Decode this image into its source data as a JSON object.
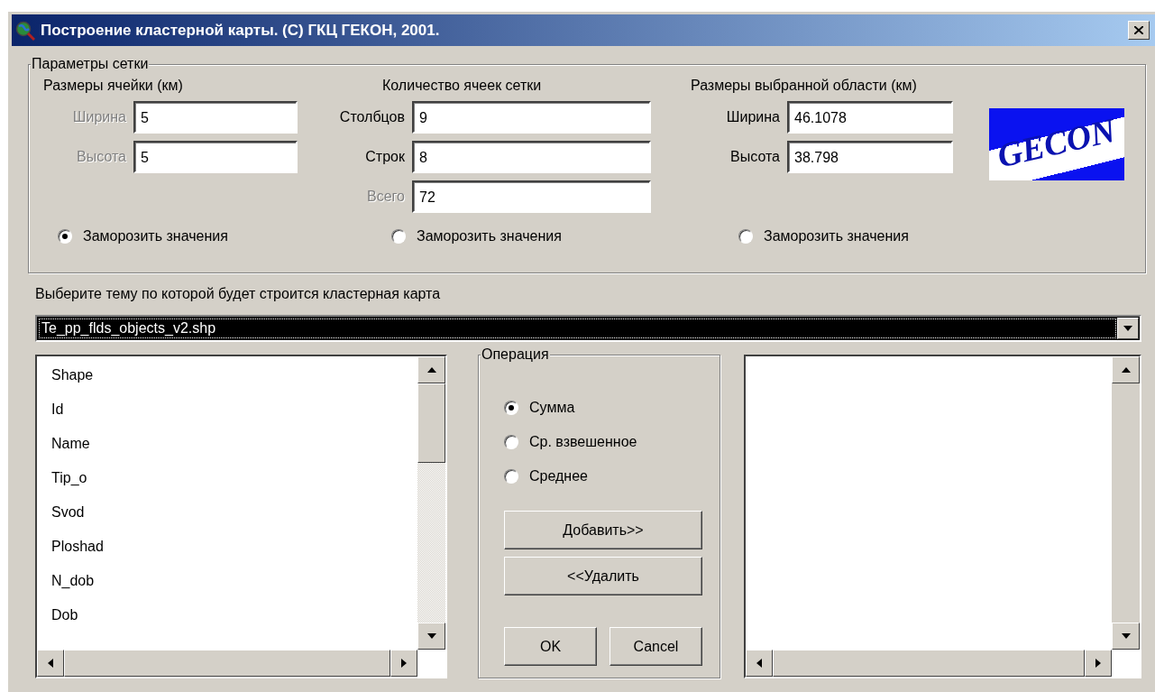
{
  "window": {
    "title": "Построение кластерной карты. (C) ГКЦ ГЕКОН, 2001."
  },
  "grid_parameters": {
    "title": "Параметры сетки",
    "columns": [
      {
        "heading": "Размеры ячейки (км)",
        "fields": [
          {
            "label": "Ширина",
            "value": "5",
            "disabled": true
          },
          {
            "label": "Высота",
            "value": "5",
            "disabled": true
          }
        ],
        "freeze": {
          "label": "Заморозить значения",
          "selected": true
        }
      },
      {
        "heading": "Количество ячеек сетки",
        "fields": [
          {
            "label": "Столбцов",
            "value": "9",
            "disabled": false
          },
          {
            "label": "Строк",
            "value": "8",
            "disabled": false
          },
          {
            "label": "Всего",
            "value": "72",
            "disabled": true
          }
        ],
        "freeze": {
          "label": "Заморозить значения",
          "selected": false
        }
      },
      {
        "heading": "Размеры выбранной области (км)",
        "fields": [
          {
            "label": "Ширина",
            "value": "46.1078",
            "disabled": false
          },
          {
            "label": "Высота",
            "value": "38.798",
            "disabled": false
          }
        ],
        "freeze": {
          "label": "Заморозить значения",
          "selected": false
        }
      }
    ],
    "logo": {
      "text": "GECON"
    }
  },
  "theme": {
    "prompt": "Выберите тему по которой будет строится кластерная карта",
    "dropdown": {
      "value": "Te_pp_flds_objects_v2.shp"
    }
  },
  "fields_list": {
    "items": [
      "Shape",
      "Id",
      "Name",
      "Tip_o",
      "Svod",
      "Ploshad",
      "N_dob",
      "Dob"
    ]
  },
  "operation": {
    "title": "Операция",
    "options": [
      {
        "label": "Сумма",
        "selected": true
      },
      {
        "label": "Ср. взвешенное",
        "selected": false
      },
      {
        "label": "Среднее",
        "selected": false
      }
    ],
    "buttons": [
      {
        "label": "Добавить>>"
      },
      {
        "label": "<<Удалить"
      }
    ]
  },
  "dialog_buttons": [
    {
      "label": "OK"
    },
    {
      "label": "Cancel"
    }
  ]
}
